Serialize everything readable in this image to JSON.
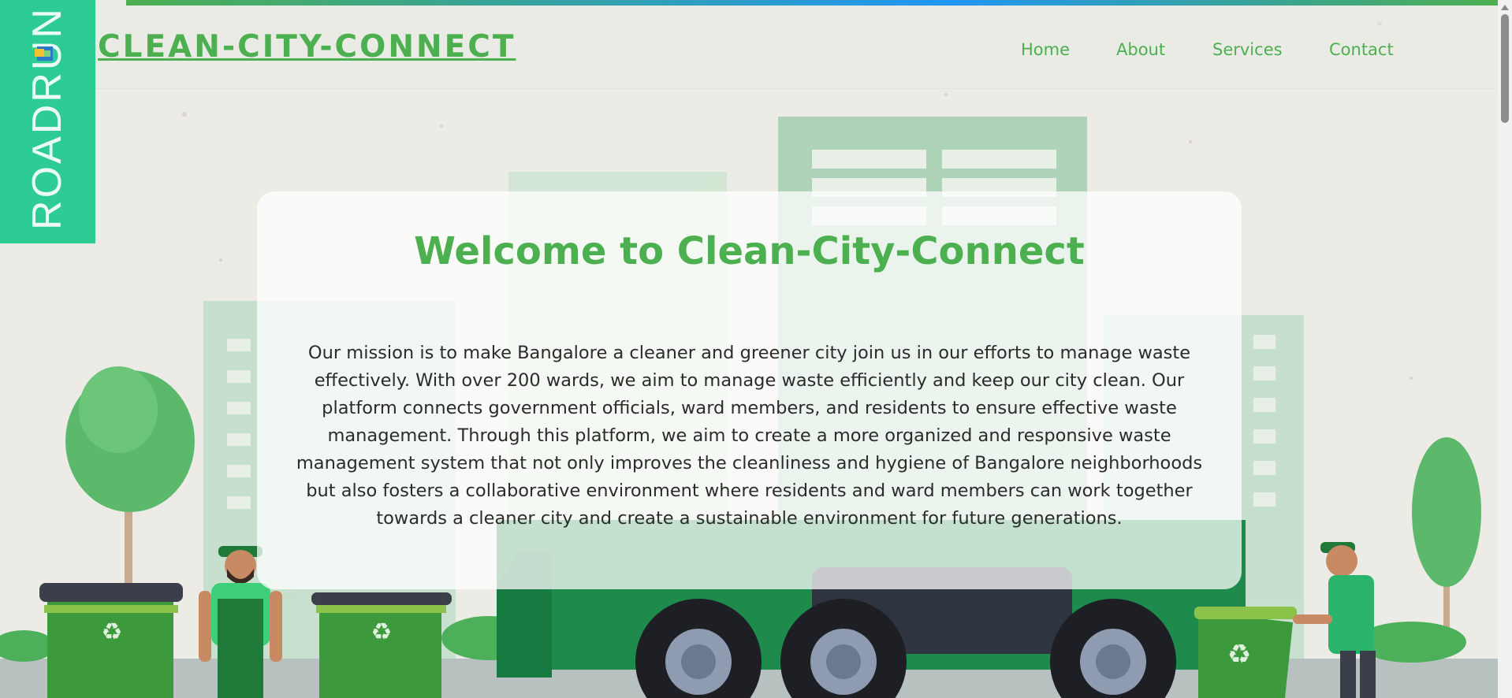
{
  "logo": {
    "text": "ROADRUN"
  },
  "brand": {
    "title": "CLEAN-CITY-CONNECT"
  },
  "nav": {
    "home": "Home",
    "about": "About",
    "services": "Services",
    "contact": "Contact"
  },
  "hero": {
    "title": "Welcome to Clean-City-Connect",
    "text": "Our mission is to make Bangalore a cleaner and greener city join us in our efforts to manage waste effectively. With over 200 wards, we aim to manage waste efficiently and keep our city clean. Our platform connects government officials, ward members, and residents to ensure effective waste management. Through this platform, we aim to create a more organized and responsive waste management system that not only improves the cleanliness and hygiene of Bangalore neighborhoods but also fosters a collaborative environment where residents and ward members can work together towards a cleaner city and create a sustainable environment for future generations."
  },
  "colors": {
    "brand_green": "#4caf50",
    "logo_teal": "#2ecc95",
    "bin_green": "#3c9a3c",
    "bin_lid": "#3a3f4a",
    "truck_green": "#1e8a4c",
    "text": "#2b2b2b"
  },
  "icons": [
    "recycle-icon",
    "logo-mark-icon"
  ]
}
